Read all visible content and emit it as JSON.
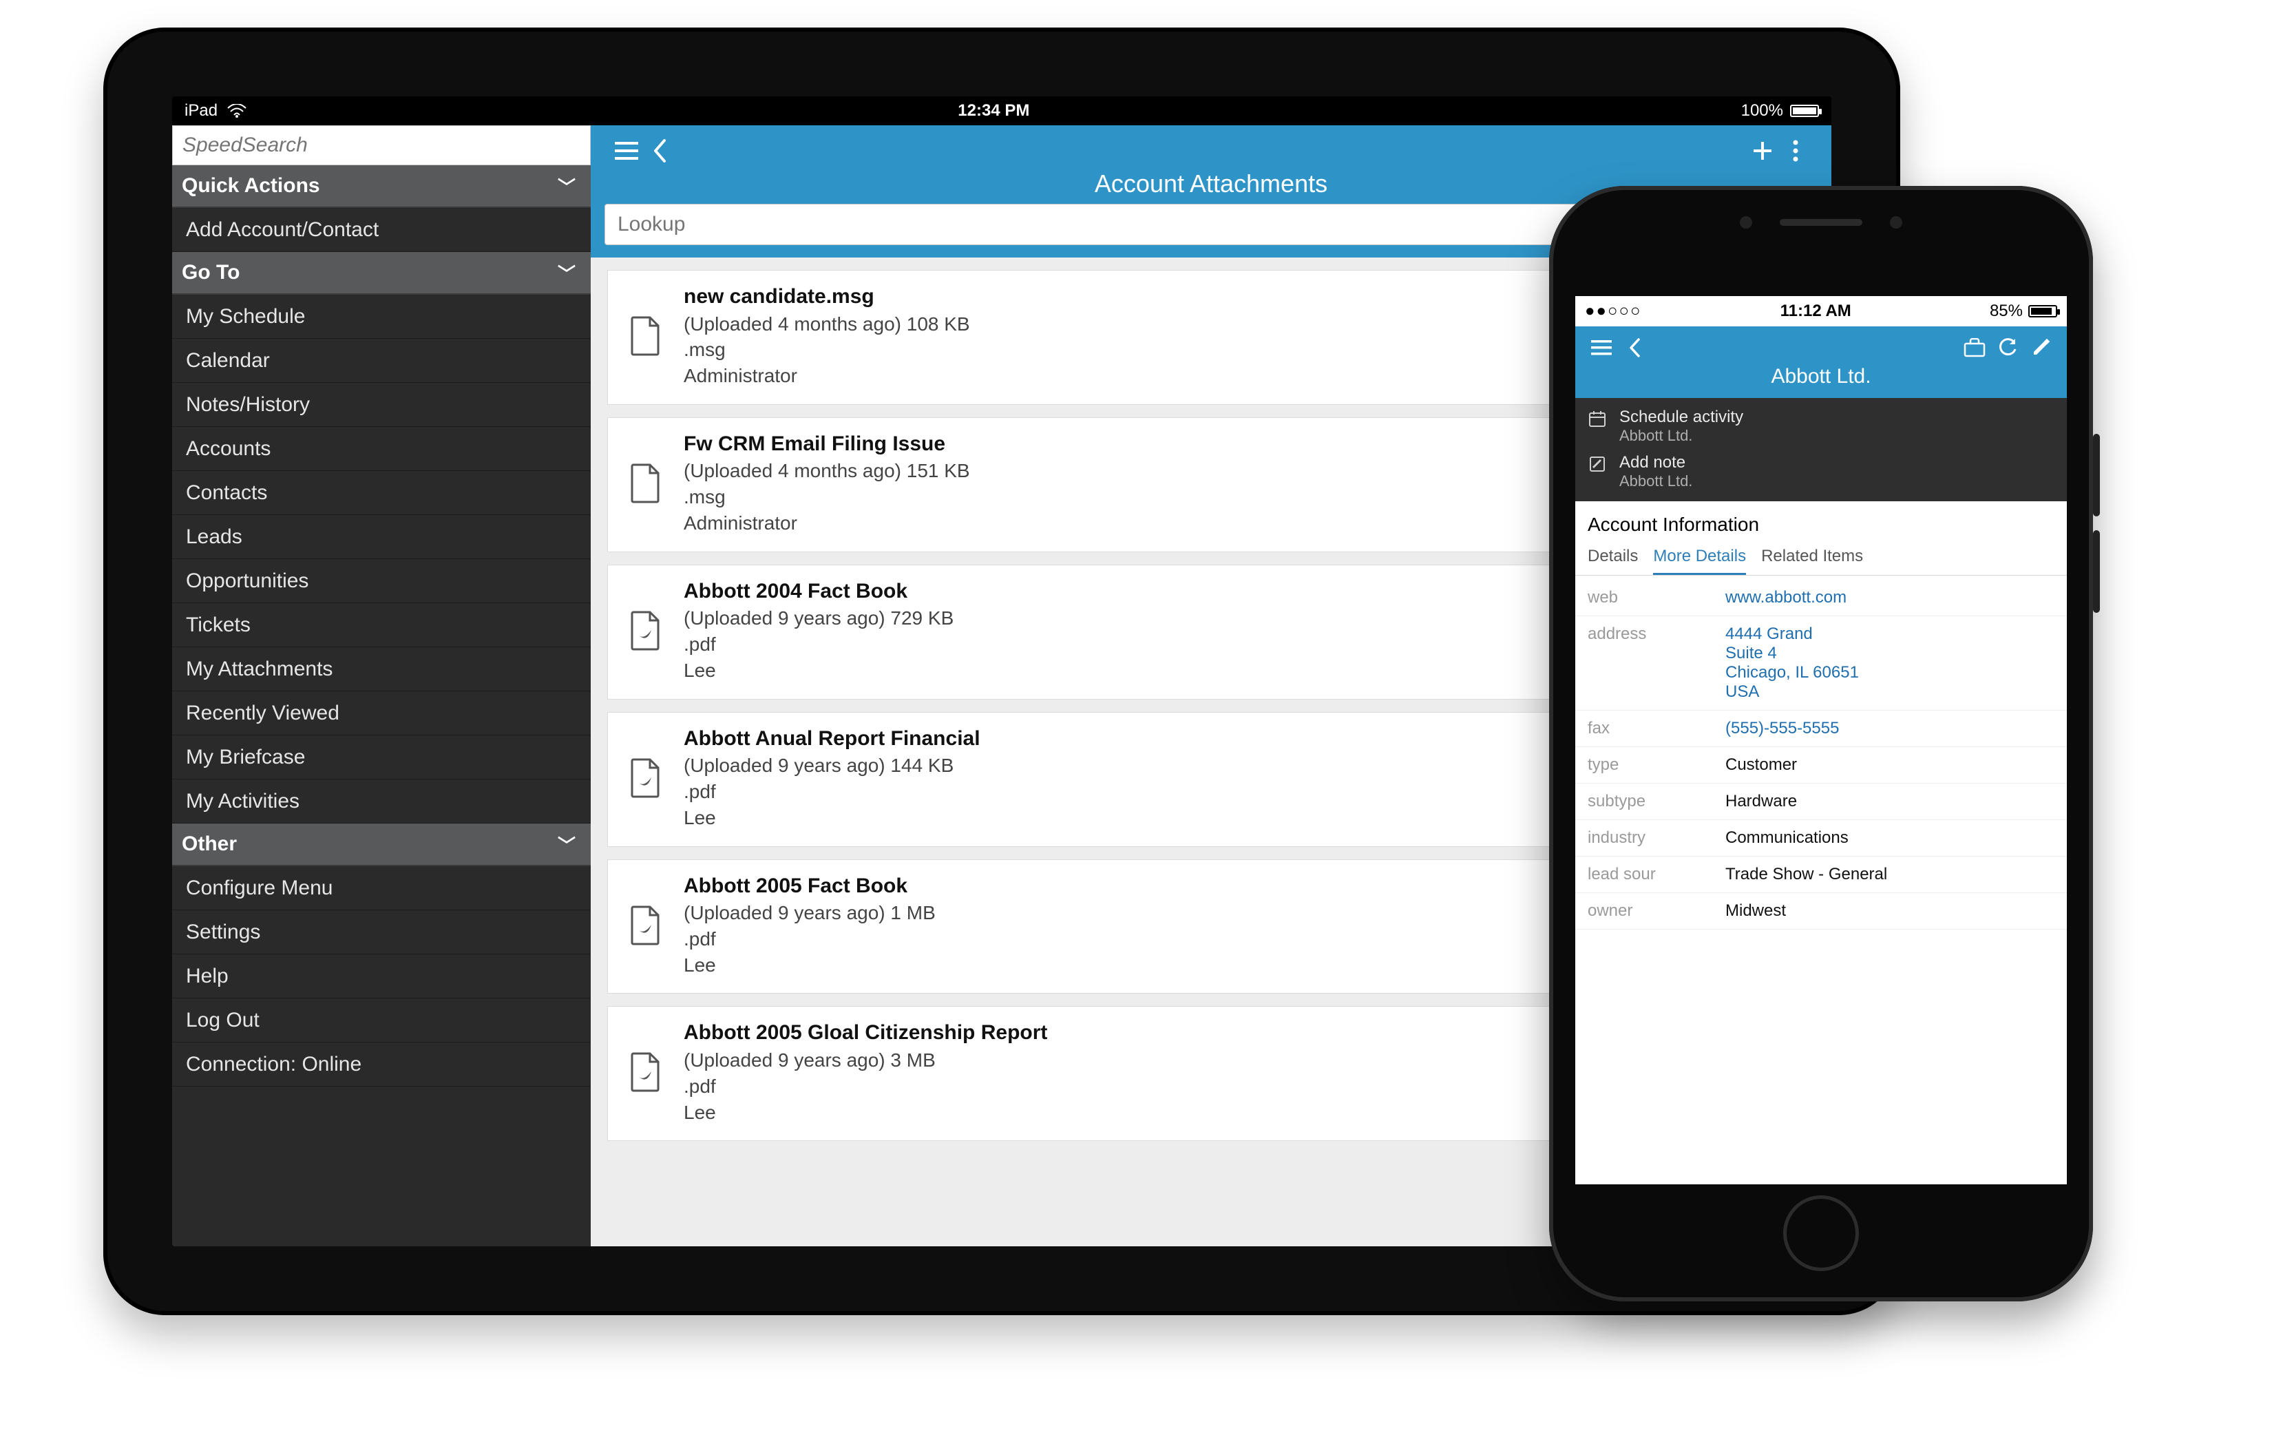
{
  "ipad": {
    "statusbar": {
      "device": "iPad",
      "time": "12:34 PM",
      "battery_text": "100%"
    },
    "sidebar": {
      "search_placeholder": "SpeedSearch",
      "sections": {
        "quick_actions": {
          "title": "Quick Actions",
          "items": [
            "Add Account/Contact"
          ]
        },
        "go_to": {
          "title": "Go To",
          "items": [
            "My Schedule",
            "Calendar",
            "Notes/History",
            "Accounts",
            "Contacts",
            "Leads",
            "Opportunities",
            "Tickets",
            "My Attachments",
            "Recently Viewed",
            "My Briefcase",
            "My Activities"
          ]
        },
        "other": {
          "title": "Other",
          "items": [
            "Configure Menu",
            "Settings",
            "Help",
            "Log Out",
            "Connection: Online"
          ]
        }
      }
    },
    "main": {
      "title": "Account Attachments",
      "lookup_placeholder": "Lookup",
      "attachments": [
        {
          "title": "new candidate.msg",
          "meta": "(Uploaded 4 months ago) 108 KB",
          "ext": ".msg",
          "user": "Administrator",
          "icon": "doc"
        },
        {
          "title": "Fw CRM Email Filing Issue",
          "meta": "(Uploaded 4 months ago) 151 KB",
          "ext": ".msg",
          "user": "Administrator",
          "icon": "doc"
        },
        {
          "title": "Abbott 2004 Fact Book",
          "meta": "(Uploaded 9 years ago) 729 KB",
          "ext": ".pdf",
          "user": "Lee",
          "icon": "pdf"
        },
        {
          "title": "Abbott Anual Report Financial",
          "meta": "(Uploaded 9 years ago) 144 KB",
          "ext": ".pdf",
          "user": "Lee",
          "icon": "pdf"
        },
        {
          "title": "Abbott 2005 Fact Book",
          "meta": "(Uploaded 9 years ago) 1 MB",
          "ext": ".pdf",
          "user": "Lee",
          "icon": "pdf"
        },
        {
          "title": "Abbott 2005 Gloal Citizenship Report",
          "meta": "(Uploaded 9 years ago) 3 MB",
          "ext": ".pdf",
          "user": "Lee",
          "icon": "pdf"
        }
      ]
    }
  },
  "iphone": {
    "statusbar": {
      "signal": "●●○○○",
      "time": "11:12 AM",
      "battery_text": "85%"
    },
    "header_title": "Abbott Ltd.",
    "quick": [
      {
        "primary": "Schedule activity",
        "secondary": "Abbott Ltd.",
        "icon": "calendar"
      },
      {
        "primary": "Add note",
        "secondary": "Abbott Ltd.",
        "icon": "note"
      }
    ],
    "section_title": "Account Information",
    "tabs": [
      "Details",
      "More Details",
      "Related Items"
    ],
    "active_tab": 1,
    "details": [
      {
        "label": "web",
        "value_lines": [
          "www.abbott.com"
        ],
        "link": true
      },
      {
        "label": "address",
        "value_lines": [
          "4444 Grand",
          "Suite 4",
          "Chicago, IL 60651",
          "USA"
        ],
        "link": true
      },
      {
        "label": "fax",
        "value_lines": [
          "(555)-555-5555"
        ],
        "link": true
      },
      {
        "label": "type",
        "value_lines": [
          "Customer"
        ],
        "link": false
      },
      {
        "label": "subtype",
        "value_lines": [
          "Hardware"
        ],
        "link": false
      },
      {
        "label": "industry",
        "value_lines": [
          "Communications"
        ],
        "link": false
      },
      {
        "label": "lead sour",
        "value_lines": [
          "Trade Show - General"
        ],
        "link": false
      },
      {
        "label": "owner",
        "value_lines": [
          "Midwest"
        ],
        "link": false
      }
    ]
  }
}
